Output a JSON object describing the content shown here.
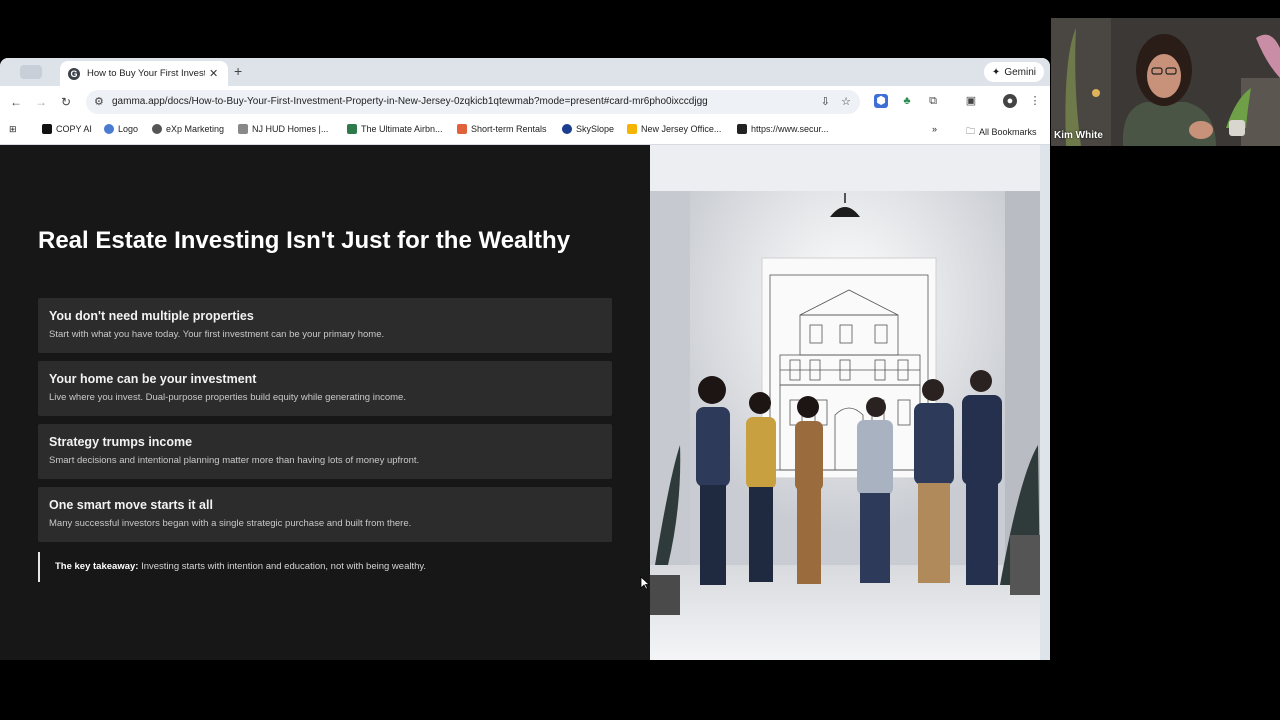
{
  "browser": {
    "tab_title": "How to Buy Your First Investm",
    "gemini_label": "Gemini",
    "url": "gamma.app/docs/How-to-Buy-Your-First-Investment-Property-in-New-Jersey-0zqkicb1qtewmab?mode=present#card-mr6pho0ixccdjgg"
  },
  "bookmarks": [
    {
      "label": "COPY AI",
      "color": "#111111"
    },
    {
      "label": "Logo",
      "color": "#4a7bd0"
    },
    {
      "label": "eXp Marketing",
      "color": "#555555"
    },
    {
      "label": "NJ HUD Homes |...",
      "color": "#888888"
    },
    {
      "label": "The Ultimate Airbn...",
      "color": "#2f7a4a"
    },
    {
      "label": "Short-term Rentals",
      "color": "#e0613a"
    },
    {
      "label": "SkySlope",
      "color": "#1a3d8f"
    },
    {
      "label": "New Jersey Office...",
      "color": "#f4b400"
    },
    {
      "label": "https://www.secur...",
      "color": "#222222"
    }
  ],
  "all_bookmarks_label": "All Bookmarks",
  "slide": {
    "heading": "Real Estate Investing Isn't Just for the Wealthy",
    "cards": [
      {
        "title": "You don't need multiple properties",
        "desc": "Start with what you have today. Your first investment can be your primary home."
      },
      {
        "title": "Your home can be your investment",
        "desc": "Live where you invest. Dual-purpose properties build equity while generating income."
      },
      {
        "title": "Strategy trumps income",
        "desc": "Smart decisions and intentional planning matter more than having lots of money upfront."
      },
      {
        "title": "One smart move starts it all",
        "desc": "Many successful investors began with a single strategic purchase and built from there."
      }
    ],
    "takeaway_label": "The key takeaway:",
    "takeaway_text": " Investing starts with intention and education, not with being wealthy."
  },
  "video": {
    "name": "Kim White"
  },
  "colors": {
    "accent": "#4a6fa5",
    "slide_bg": "#171717",
    "card_bg": "#2c2c2c"
  }
}
